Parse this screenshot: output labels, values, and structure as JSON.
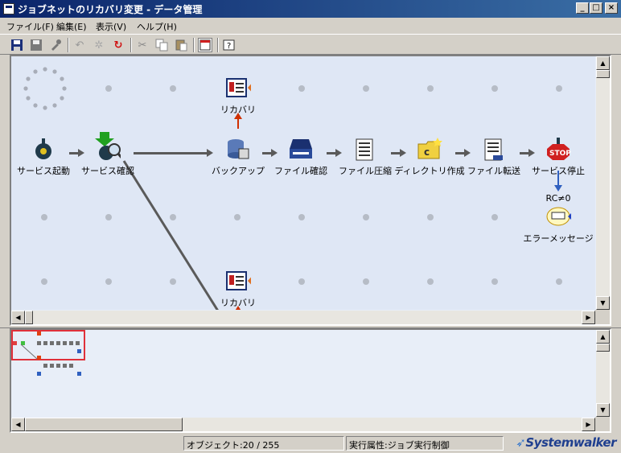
{
  "window": {
    "title": "ジョブネットのリカバリ変更 - データ管理",
    "minimize": "_",
    "maximize": "□",
    "close": "×"
  },
  "menu": [
    "ファイル(F)",
    "編集(E)",
    "表示(V)",
    "ヘルプ(H)"
  ],
  "nodes": {
    "service_start": "サービス起動",
    "service_check": "サービス確認",
    "backup": "バックアップ",
    "file_check": "ファイル確認",
    "file_compress": "ファイル圧縮",
    "dir_create": "ディレクトリ作成",
    "file_transfer": "ファイル転送",
    "service_stop": "サービス停止",
    "recovery_top": "リカバリ",
    "recovery_bottom": "リカバリ",
    "condition": "RC≠0",
    "error_message": "エラーメッセージ"
  },
  "status": {
    "objects": "オブジェクト:20 / 255",
    "exec_attr": "実行属性:ジョブ実行制御",
    "brand": "Systemwalker"
  },
  "colors": {
    "canvas": "#dfe7f5",
    "titlebar": "#0a246a",
    "minimap_frame": "#e0303a",
    "flow_line": "#5a5a5a",
    "recovery_arrow": "#c03000"
  }
}
